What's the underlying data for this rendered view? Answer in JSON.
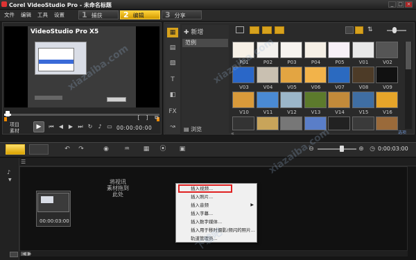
{
  "window": {
    "title": "Corel VideoStudio Pro - 未命名标题",
    "minimize": "_",
    "maximize": "□",
    "close": "×"
  },
  "menu": [
    "文件",
    "编辑",
    "工具",
    "设置"
  ],
  "steps": [
    {
      "num": "1",
      "label": "捕获"
    },
    {
      "num": "2",
      "label": "编辑"
    },
    {
      "num": "3",
      "label": "分享"
    }
  ],
  "player": {
    "screen_title": "VideoStudio Pro X5",
    "project_label": "项目",
    "clip_label": "素材",
    "timecode": "00:00:00:00"
  },
  "library": {
    "add_label": "新增",
    "tree_item": "范例",
    "browse_label": "浏览",
    "options_label": "选项",
    "thumbnails": [
      {
        "label": "P01",
        "color": "#f6f0e6"
      },
      {
        "label": "P02",
        "color": "#f3f1ee"
      },
      {
        "label": "P03",
        "color": "#f6f3ef"
      },
      {
        "label": "P04",
        "color": "#f5efe5"
      },
      {
        "label": "P05",
        "color": "#f7f0f7"
      },
      {
        "label": "V01",
        "color": "#e8e8e8"
      },
      {
        "label": "V02",
        "color": "#555555"
      },
      {
        "label": "V03",
        "color": "#2a67c8"
      },
      {
        "label": "V04",
        "color": "#c9c0b1"
      },
      {
        "label": "V05",
        "color": "#e3a542"
      },
      {
        "label": "V06",
        "color": "#f2b34a"
      },
      {
        "label": "V07",
        "color": "#2b6ac0"
      },
      {
        "label": "V08",
        "color": "#4d3b27"
      },
      {
        "label": "V09",
        "color": "#111111"
      },
      {
        "label": "V10",
        "color": "#d99a3a"
      },
      {
        "label": "V11",
        "color": "#4a8ad4"
      },
      {
        "label": "V12",
        "color": "#9bb6c9"
      },
      {
        "label": "V13",
        "color": "#5c7a2c"
      },
      {
        "label": "V14",
        "color": "#c28a3a"
      },
      {
        "label": "V15",
        "color": "#3f6ea3"
      },
      {
        "label": "V16",
        "color": "#e6a52a"
      }
    ]
  },
  "timeline": {
    "time": "0:00:03:00",
    "clip_time": "00:00:03:00",
    "placeholder_lines": [
      "将视讯",
      "素材拖到",
      "此处"
    ]
  },
  "context_menu": [
    {
      "label": "插入视频...",
      "submenu": false
    },
    {
      "label": "插入照片...",
      "submenu": false
    },
    {
      "label": "插入音频",
      "submenu": true
    },
    {
      "label": "插入字幕...",
      "submenu": false
    },
    {
      "label": "插入数字媒体...",
      "submenu": false
    },
    {
      "label": "插入用于移时摄影/频闪的照片...",
      "submenu": false
    },
    {
      "label": "轨道管理员..."
    }
  ],
  "watermarks": [
    "下载吧",
    "xiazaiba.com"
  ]
}
